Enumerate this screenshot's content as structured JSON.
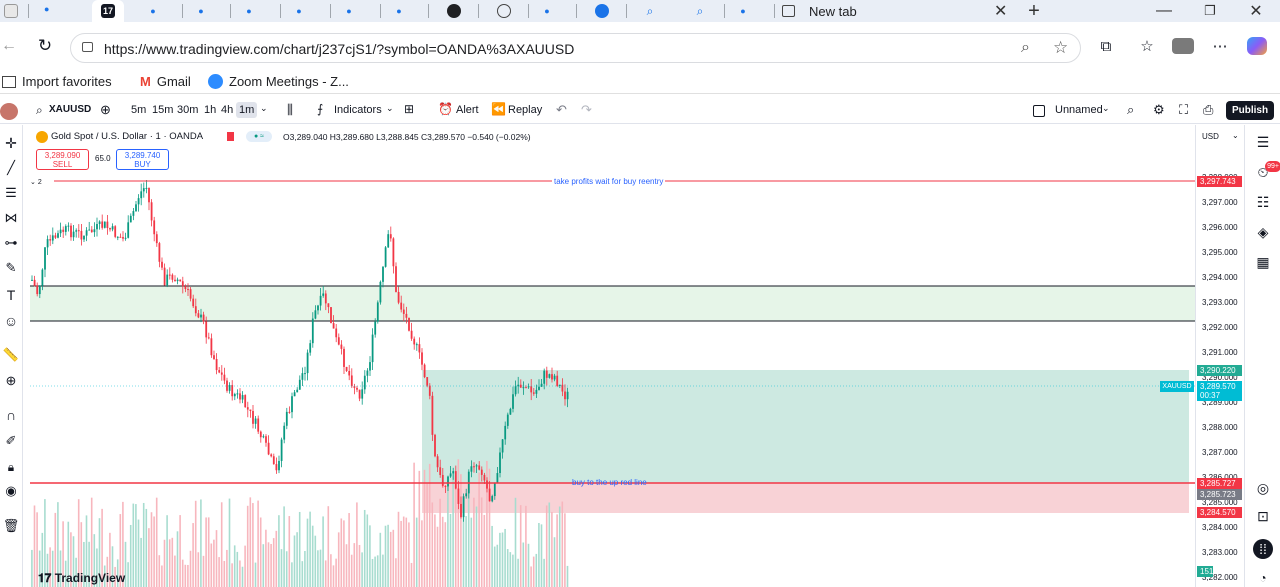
{
  "browser": {
    "active_tab_title": "",
    "new_tab_title": "New tab",
    "url": "https://www.tradingview.com/chart/j237cjS1/?symbol=OANDA%3AXAUUSD",
    "bookmarks": [
      "Import favorites",
      "Gmail",
      "Zoom Meetings - Z..."
    ]
  },
  "toolbar": {
    "symbol": "XAUUSD",
    "intervals": [
      "5m",
      "15m",
      "30m",
      "1h",
      "4h",
      "1m"
    ],
    "indicators": "Indicators",
    "alert": "Alert",
    "replay": "Replay",
    "layout_name": "Unnamed",
    "publish": "Publish"
  },
  "legend": {
    "title": "Gold Spot / U.S. Dollar · 1 · OANDA",
    "ohlc": "O3,289.040 H3,289.680 L3,288.845 C3,289.570 −0.540 (−0.02%)",
    "sell_price": "3,289.090",
    "sell_label": "SELL",
    "spread": "65.0",
    "buy_price": "3,289.740",
    "buy_label": "BUY",
    "collapse_count": "2"
  },
  "price_scale": {
    "currency": "USD",
    "ticks": [
      "3,298.000",
      "3,297.000",
      "3,296.000",
      "3,295.000",
      "3,294.000",
      "3,293.000",
      "3,292.000",
      "3,291.000",
      "3,290.000",
      "3,289.000",
      "3,288.000",
      "3,287.000",
      "3,286.000",
      "3,285.000",
      "3,284.000",
      "3,283.000",
      "3,282.000"
    ],
    "labels": {
      "take_profit": "3,297.743",
      "target": "3,290.220",
      "current": "3,289.570",
      "countdown": "00:37",
      "buy_line": "3,285.727",
      "entry": "3,285.723",
      "stop": "3,284.570",
      "volume": "151"
    },
    "symbol_tag": "XAUUSD"
  },
  "annotations": {
    "top_line_text": "take profits wait for buy reentry",
    "bottom_line_text": "buy to the up red line"
  },
  "footer": {
    "brand": "TradingView"
  },
  "notifications": "99+",
  "colors": {
    "red_line": "#f23645",
    "green_zone": "#d6f2e6",
    "position_green": "#cde9e1",
    "position_red": "#f8d2d6",
    "candle_up": "#089981",
    "candle_down": "#f23645",
    "label_teal": "#22ab94",
    "label_cyan": "#00bcd4",
    "publish_bg": "#131722"
  }
}
